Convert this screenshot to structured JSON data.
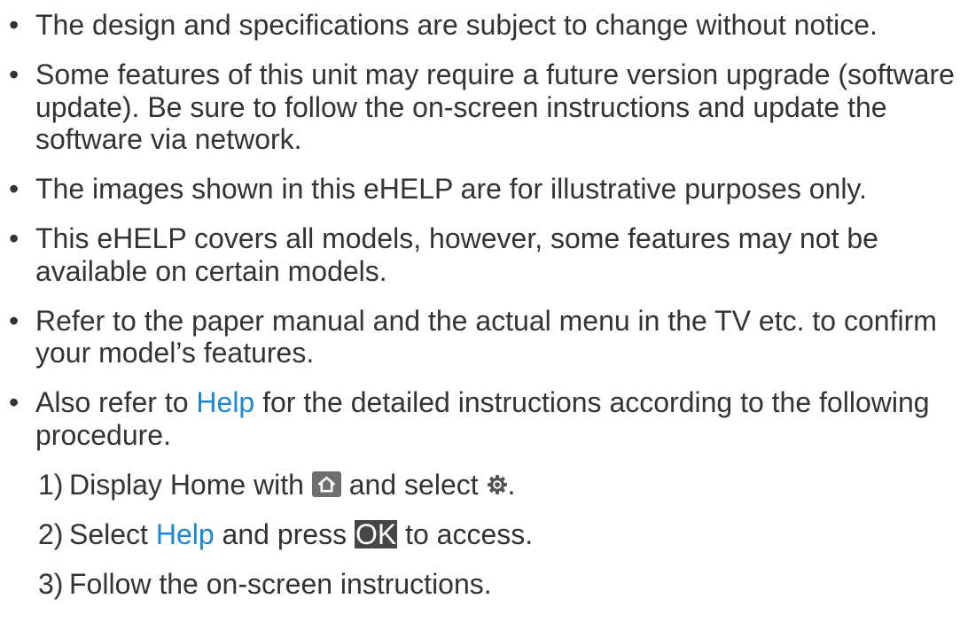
{
  "bullet_symbol": "•",
  "bullets": [
    {
      "lines": [
        "The design and specifications are subject to change without notice."
      ]
    },
    {
      "lines": [
        "Some features of this unit may require a future version upgrade (software",
        "update). Be sure to follow the on-screen instructions and update the",
        "software via network."
      ]
    },
    {
      "lines": [
        "The images shown in this eHELP are for illustrative purposes only."
      ]
    },
    {
      "lines": [
        "This eHELP covers all models, however, some features may not be",
        "available on certain models."
      ]
    },
    {
      "lines": [
        "Refer to the paper manual and the actual menu in the TV etc. to confirm",
        "your model’s features."
      ]
    },
    {
      "line1": {
        "before": "Also refer to ",
        "link": "Help",
        "after": " for the detailed instructions according to the following"
      },
      "line2": "procedure."
    }
  ],
  "steps": [
    {
      "number": "1)",
      "text_before": "Display Home with ",
      "text_middle": " and select ",
      "text_after": ".",
      "icons": [
        "home-icon",
        "settings-icon"
      ]
    },
    {
      "number": "2)",
      "text_before": "Select ",
      "link": "Help",
      "text_middle": " and press ",
      "key": "OK",
      "text_after": " to access."
    },
    {
      "number": "3)",
      "text": "Follow the on-screen instructions."
    }
  ],
  "colors": {
    "background": "#ffffff",
    "text": "#333333",
    "link": "#1c87d3",
    "home_icon_bg": "#6e6e6e",
    "key_bg": "#464646",
    "key_text": "#ffffff",
    "gear": "#555555"
  }
}
